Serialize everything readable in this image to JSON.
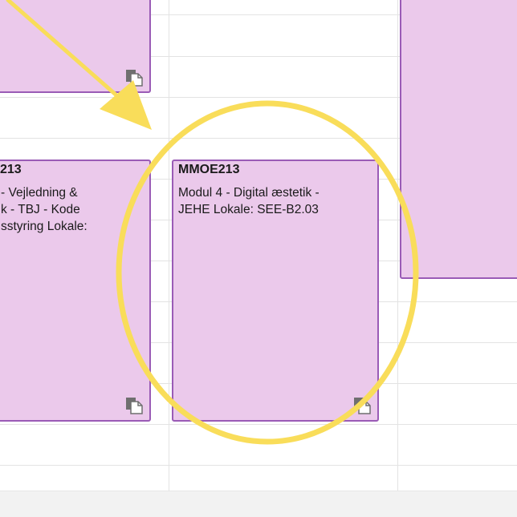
{
  "events": [
    {
      "code": "",
      "description": ""
    },
    {
      "code": "213",
      "description": "- Vejledning &\nk - TBJ - Kode\nsstyring Lokale:"
    },
    {
      "code": "MMOE213",
      "description": "Modul 4 - Digital æstetik -\nJEHE Lokale: SEE-B2.03"
    },
    {
      "code": "",
      "description": ""
    }
  ],
  "colors": {
    "event_fill": "#ebc9eb",
    "event_border": "#9a5bb6",
    "annotation": "#f9dd5a",
    "grid_line": "#e3e3e3"
  },
  "icons": {
    "event_action": "copy-document-icon"
  }
}
